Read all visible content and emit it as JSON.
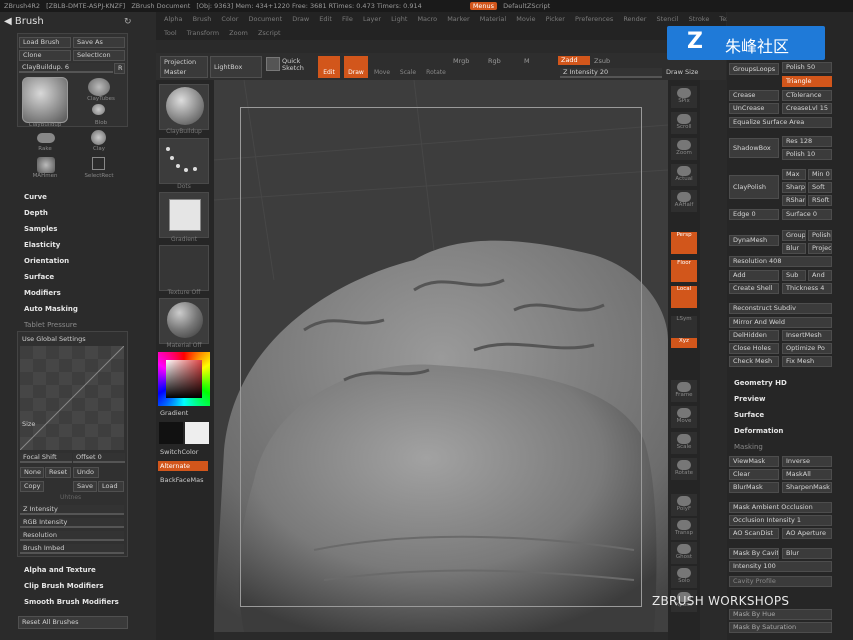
{
  "title_bar": {
    "app": "ZBrush4R2",
    "build": "[ZBLB-DMTE-ASPJ-KNZF]",
    "document": "ZBrush Document",
    "stats": "[Obj: 9363]  Mem: 434+1220  Free: 3681  RTimes: 0.473  Timers: 0.914",
    "menus_button": "Menus",
    "script": "DefaultZScript"
  },
  "menubar": {
    "items": [
      "Alpha",
      "Brush",
      "Color",
      "Document",
      "Draw",
      "Edit",
      "File",
      "Layer",
      "Light",
      "Macro",
      "Marker",
      "Material",
      "Movie",
      "Picker",
      "Preferences",
      "Render",
      "Stencil",
      "Stroke",
      "Texture"
    ],
    "row2": [
      "Tool",
      "Transform",
      "Zoom",
      "Zscript"
    ]
  },
  "brush_panel": {
    "title": "Brush",
    "load_brush": "Load Brush",
    "save_as": "Save As",
    "clone": "Clone",
    "selection": "SelectIcon",
    "current_brush": "ClayBuildup. 6",
    "r_label": "R",
    "brushes": [
      "ClayBuildup",
      "ClayTubes",
      "Blob",
      "Rake",
      "Clay",
      "MAHmen",
      "SelectRect"
    ],
    "sections": [
      "Curve",
      "Depth",
      "Samples",
      "Elasticity",
      "Orientation",
      "Surface",
      "Modifiers",
      "Auto Masking",
      "Tablet Pressure"
    ],
    "use_global": "Use Global Settings",
    "size_label": "Size",
    "focal_shift": "Focal Shift",
    "offset_label": "Offset",
    "offset_value": "0",
    "none_label": "None",
    "reset_label": "Reset",
    "undo_label": "Undo",
    "copy_label": "Copy",
    "save_label": "Save",
    "load_label": "Load",
    "ghost_label": "Uhtnes",
    "z_intensity": "Z Intensity",
    "rgb_intensity": "RGB Intensity",
    "resolution": "Resolution",
    "brush_imbed": "Brush Imbed",
    "alpha_texture": "Alpha and Texture",
    "clip_modifiers": "Clip Brush Modifiers",
    "smooth_modifiers": "Smooth Brush Modifiers",
    "reset_all": "Reset All Brushes"
  },
  "top_toolbar": {
    "projection_master": "Projection Master",
    "lightbox": "LightBox",
    "quick_sketch": "Quick Sketch",
    "edit": "Edit",
    "draw": "Draw",
    "move": "Move",
    "scale": "Scale",
    "rotate": "Rotate",
    "mrgb": "Mrgb",
    "rgb": "Rgb",
    "m": "M",
    "zadd": "Zadd",
    "zsub": "Zsub",
    "z_intensity": "Z Intensity 20",
    "draw_size": "Draw Size"
  },
  "shelf": {
    "labels": [
      "ClayBuildup",
      "Dots",
      "Gradient",
      "Texture Off",
      "Material Off"
    ],
    "gradient": "Gradient",
    "switch_color": "SwitchColor",
    "alternate": "Alternate",
    "backface": "BackFaceMas"
  },
  "right_toolbar": [
    "SPix",
    "Scroll",
    "Zoom",
    "Actual",
    "AAHalf",
    "Persp",
    "Floor",
    "Local",
    "LSym",
    "Xyz",
    "Frame",
    "Move",
    "Scale",
    "Rotate",
    "PolyF",
    "Transp",
    "Ghost",
    "Solo",
    "Xpose"
  ],
  "geometry_panel": {
    "groups_loops": "GroupsLoops",
    "polish": "Polish",
    "polish_value": "50",
    "triangle": "Triangle",
    "crease": "Crease",
    "crease_tol": "CTolerance",
    "uncrease": "UnCrease",
    "crease_lvl": "CreaseLvl",
    "crease_lvl_value": "15",
    "equalize": "Equalize Surface Area",
    "shadowbox": "ShadowBox",
    "res": "Res",
    "res_value": "128",
    "polish2": "Polish",
    "polish2_value": "10",
    "claypolish": "ClayPolish",
    "max": "Max",
    "min": "Min",
    "min_value": "0",
    "sharp": "Sharp",
    "soft": "Soft",
    "rshar": "RShar",
    "rsoft": "RSoft",
    "edge": "Edge",
    "edge_value": "0",
    "surface": "Surface",
    "surface_value": "0",
    "dynamesh": "DynaMesh",
    "group": "Group",
    "polish3": "Polish",
    "blur": "Blur",
    "project": "Projec",
    "resolution": "Resolution",
    "resolution_value": "408",
    "add": "Add",
    "sub": "Sub",
    "and": "And",
    "create_shell": "Create Shell",
    "thickness": "Thickness",
    "thickness_value": "4",
    "reconstruct": "Reconstruct Subdiv",
    "mirror_weld": "Mirror And Weld",
    "delhidden": "DelHidden",
    "insert_mesh": "InsertMesh",
    "close_holes": "Close Holes",
    "optimize": "Optimize Po",
    "check_mesh": "Check Mesh",
    "fix_mesh": "Fix Mesh",
    "geometry_hd": "Geometry HD",
    "preview": "Preview",
    "surface_sect": "Surface",
    "deformation": "Deformation",
    "masking": "Masking",
    "viewmask": "ViewMask",
    "inverse": "Inverse",
    "clear": "Clear",
    "maskall": "MaskAll",
    "blurmask": "BlurMask",
    "sharpenmask": "SharpenMask",
    "mask_ao": "Mask Ambient Occlusion",
    "occlusion": "Occlusion Intensity 1",
    "ao_scandist": "AO ScanDist",
    "ao_aperture": "AO Aperture",
    "mask_cavity": "Mask By Cavity",
    "blur2": "Blur",
    "intensity": "Intensity 100",
    "cavity_profile": "Cavity Profile",
    "mask_hue": "Mask By Hue",
    "mask_saturation": "Mask By Saturation"
  },
  "logo": {
    "mark": "Z",
    "text": "朱峰社区"
  },
  "watermark": "ZBRUSH WORKSHOPS",
  "colors": {
    "accent": "#d2561b",
    "logo_blue": "#1f7ad8"
  }
}
